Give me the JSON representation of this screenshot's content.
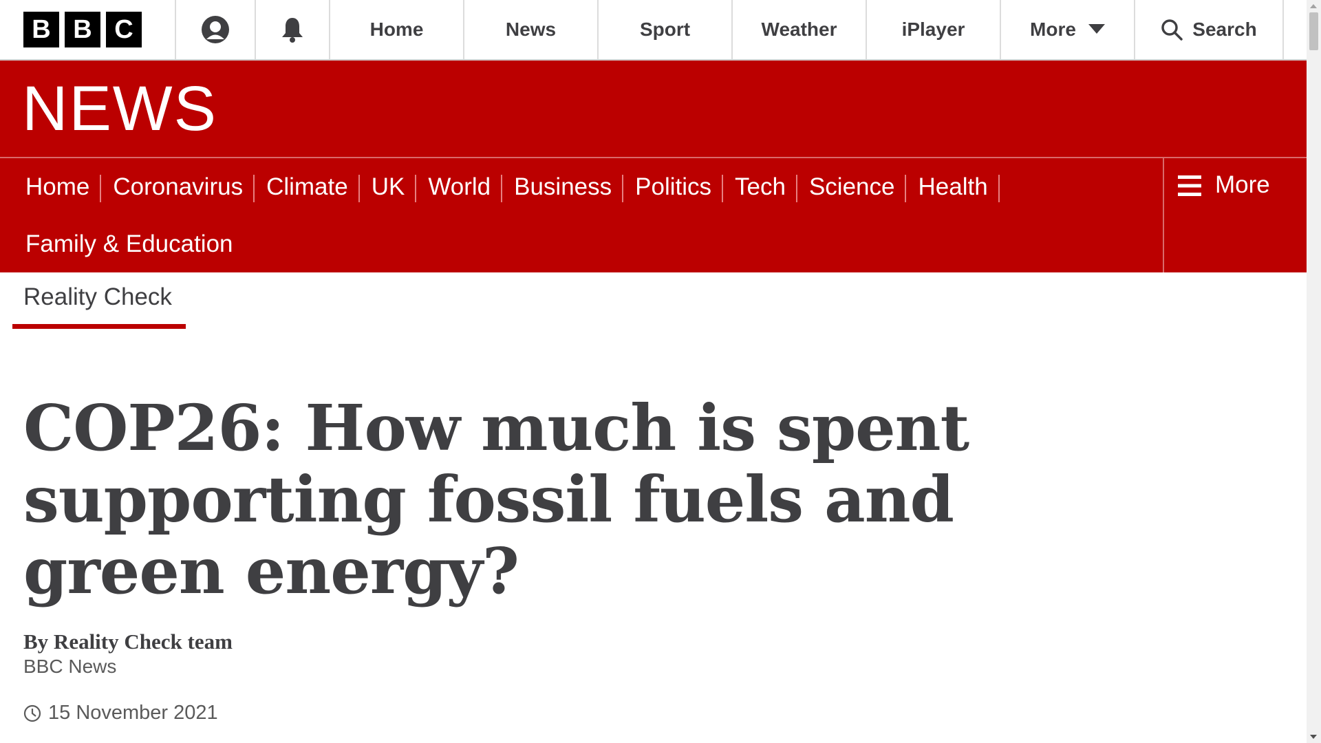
{
  "masthead": {
    "logo_letters": [
      "B",
      "B",
      "C"
    ],
    "account_icon": "account-icon",
    "notifications_icon": "bell-icon",
    "nav": [
      {
        "label": "Home"
      },
      {
        "label": "News"
      },
      {
        "label": "Sport"
      },
      {
        "label": "Weather"
      },
      {
        "label": "iPlayer"
      }
    ],
    "more_label": "More",
    "search_label": "Search"
  },
  "news_header": {
    "title": "NEWS",
    "brand_color": "#bb0000"
  },
  "section_nav": {
    "items": [
      {
        "label": "Home"
      },
      {
        "label": "Coronavirus"
      },
      {
        "label": "Climate"
      },
      {
        "label": "UK"
      },
      {
        "label": "World"
      },
      {
        "label": "Business"
      },
      {
        "label": "Politics"
      },
      {
        "label": "Tech"
      },
      {
        "label": "Science"
      },
      {
        "label": "Health"
      },
      {
        "label": "Family & Education"
      }
    ],
    "more_label": "More"
  },
  "subnav": {
    "label": "Reality Check"
  },
  "article": {
    "headline": "COP26: How much is spent supporting fossil fuels and green energy?",
    "byline": "By Reality Check team",
    "source": "BBC News",
    "date": "15 November 2021"
  }
}
